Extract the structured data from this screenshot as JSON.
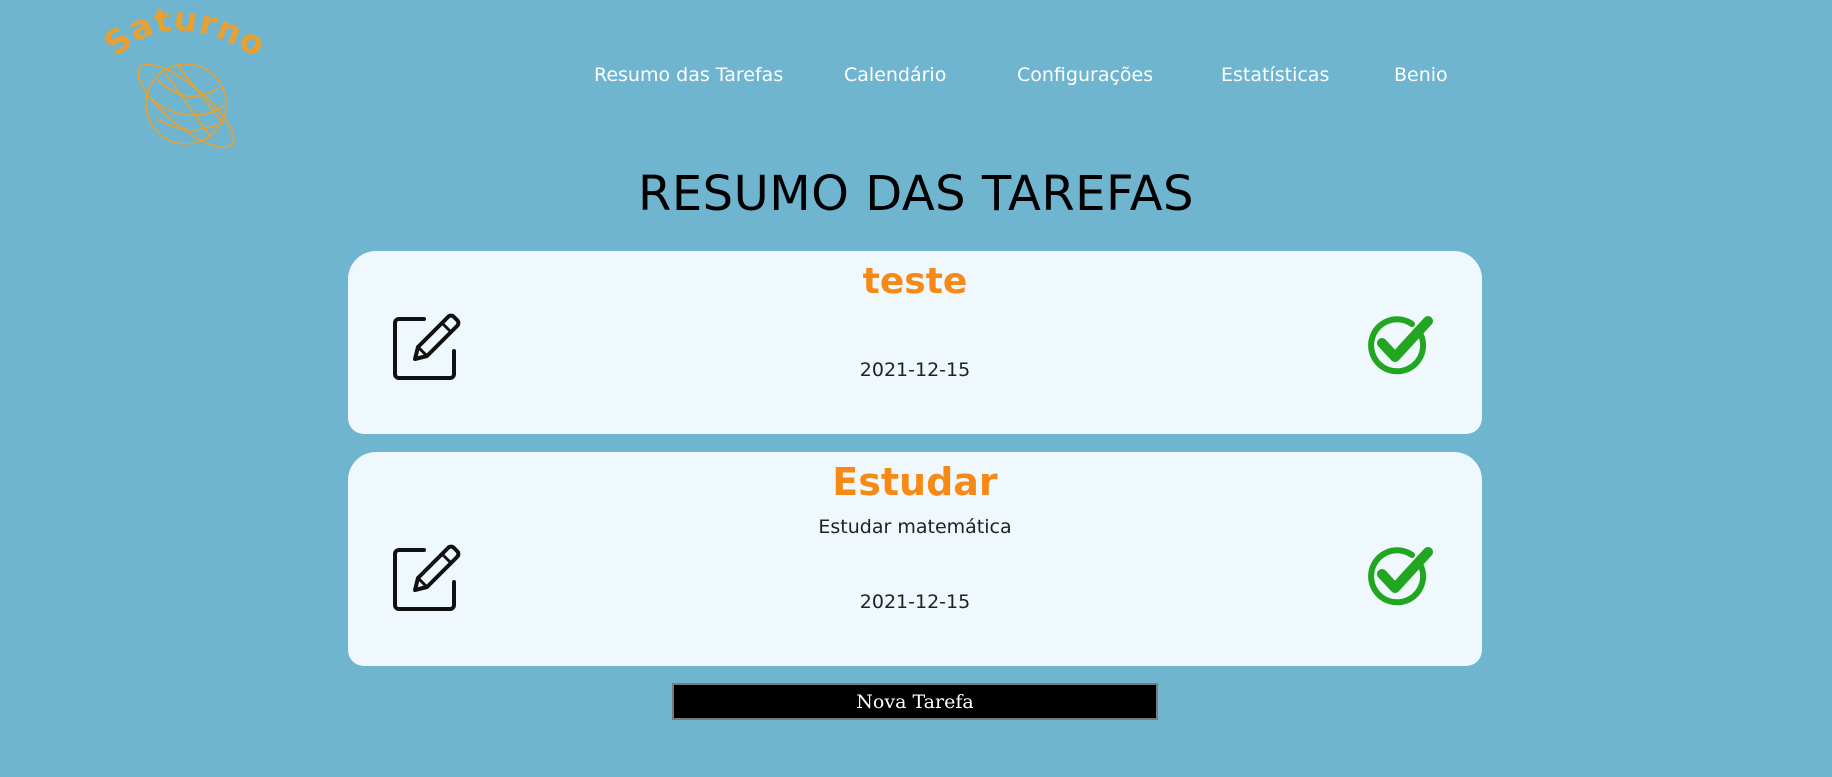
{
  "brand": {
    "logo_text": "Saturno",
    "color": "#e8a12f"
  },
  "nav": {
    "items": [
      {
        "label": "Resumo das Tarefas"
      },
      {
        "label": "Calendário"
      },
      {
        "label": "Configurações"
      },
      {
        "label": "Estatísticas"
      },
      {
        "label": "Benio"
      }
    ]
  },
  "main": {
    "title": "RESUMO DAS TAREFAS",
    "tasks": [
      {
        "title": "teste",
        "description": "",
        "date": "2021-12-15",
        "edit_icon": "edit-icon",
        "complete_icon": "check-circle-icon"
      },
      {
        "title": "Estudar",
        "description": "Estudar matemática",
        "date": "2021-12-15",
        "edit_icon": "edit-icon",
        "complete_icon": "check-circle-icon"
      }
    ],
    "new_task_label": "Nova Tarefa"
  },
  "colors": {
    "background": "#6fb5cf",
    "card": "#eff8fd",
    "task_title": "#f78a16",
    "check": "#22a521"
  }
}
